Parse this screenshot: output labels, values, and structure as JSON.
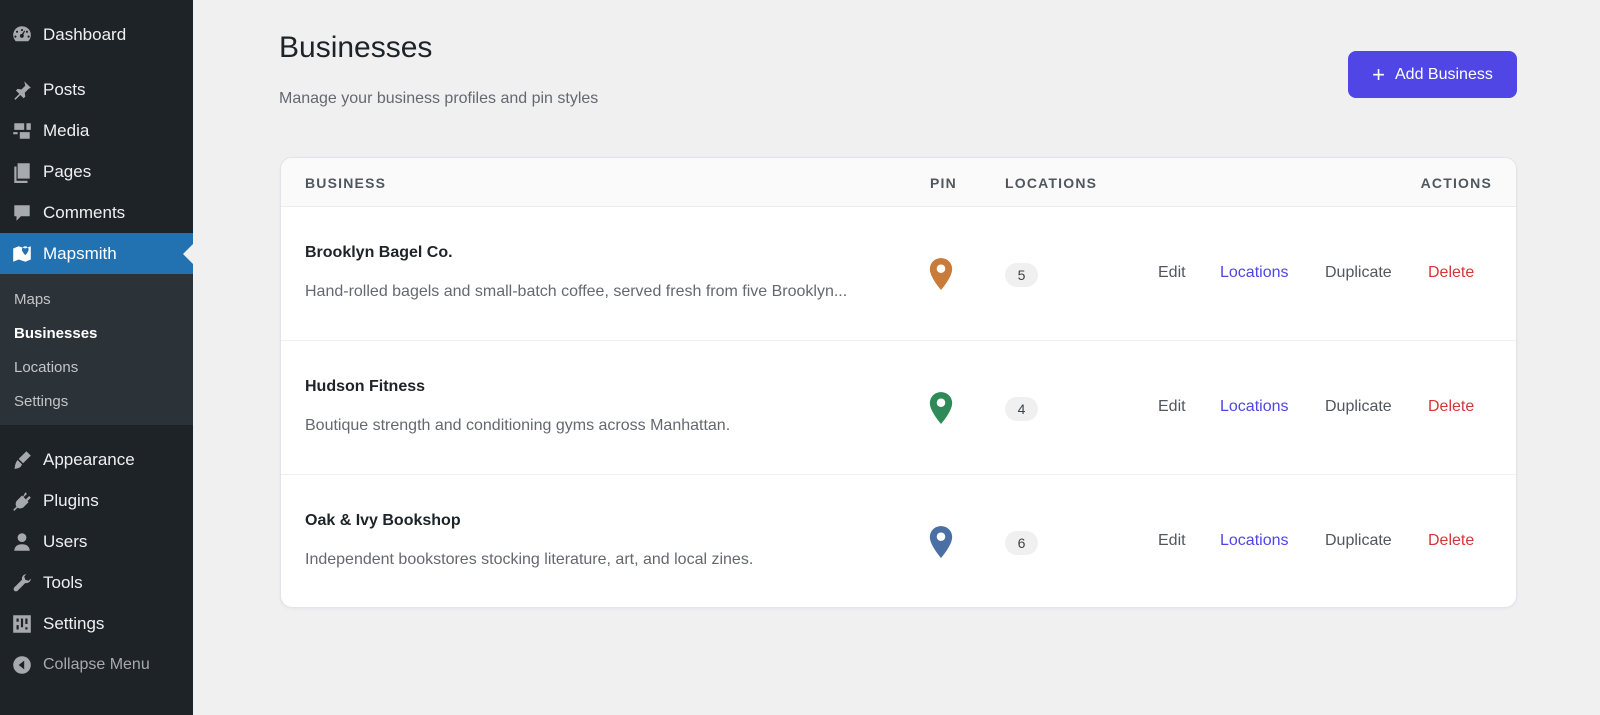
{
  "sidebar": {
    "items": [
      {
        "label": "Dashboard",
        "icon": "dashboard-icon"
      },
      {
        "label": "Posts",
        "icon": "pin-icon"
      },
      {
        "label": "Media",
        "icon": "media-icon"
      },
      {
        "label": "Pages",
        "icon": "pages-icon"
      },
      {
        "label": "Comments",
        "icon": "comment-icon"
      },
      {
        "label": "Mapsmith",
        "icon": "map-icon"
      },
      {
        "label": "Appearance",
        "icon": "brush-icon"
      },
      {
        "label": "Plugins",
        "icon": "plugin-icon"
      },
      {
        "label": "Users",
        "icon": "user-icon"
      },
      {
        "label": "Tools",
        "icon": "wrench-icon"
      },
      {
        "label": "Settings",
        "icon": "settings-icon"
      }
    ],
    "submenu": [
      "Maps",
      "Businesses",
      "Locations",
      "Settings"
    ],
    "collapse_label": "Collapse Menu"
  },
  "header": {
    "title": "Businesses",
    "subtitle": "Manage your business profiles and pin styles",
    "add_button": "Add Business"
  },
  "table": {
    "columns": {
      "business": "BUSINESS",
      "pin": "PIN",
      "locations": "LOCATIONS",
      "actions": "ACTIONS"
    },
    "actions": {
      "edit": "Edit",
      "locations": "Locations",
      "duplicate": "Duplicate",
      "delete": "Delete"
    },
    "rows": [
      {
        "name": "Brooklyn Bagel Co.",
        "description": "Hand-rolled bagels and small-batch coffee, served fresh from five Brooklyn...",
        "pin_color": "#c97b3a",
        "locations": "5"
      },
      {
        "name": "Hudson Fitness",
        "description": "Boutique strength and conditioning gyms across Manhattan.",
        "pin_color": "#2e8b57",
        "locations": "4"
      },
      {
        "name": "Oak & Ivy Bookshop",
        "description": "Independent bookstores stocking literature, art, and local zines.",
        "pin_color": "#4a6fa5",
        "locations": "6"
      }
    ]
  },
  "colors": {
    "accent": "#4f46e5",
    "active_menu": "#2271b1",
    "sidebar_bg": "#1d2327",
    "delete": "#d63638"
  }
}
